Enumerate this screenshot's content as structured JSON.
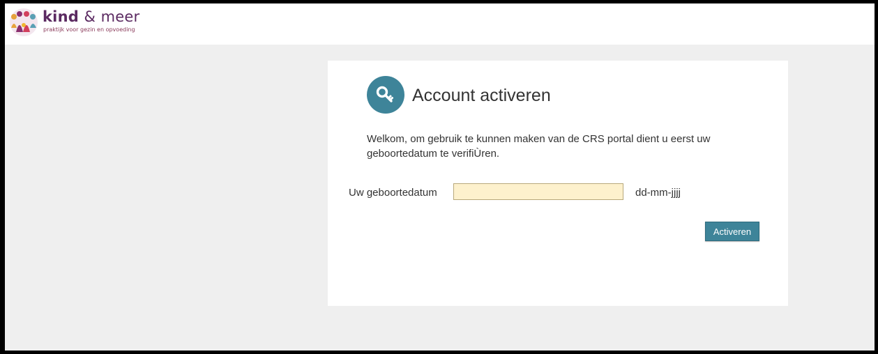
{
  "header": {
    "brand_kind": "kind",
    "brand_amp": "&",
    "brand_meer": "meer",
    "tagline": "praktijk voor gezin en opvoeding"
  },
  "card": {
    "title": "Account activeren",
    "intro": "Welkom, om gebruik te kunnen maken van de CRS portal dient u eerst uw geboortedatum te verifiÙren.",
    "dob_label": "Uw geboortedatum",
    "dob_value": "",
    "dob_hint": "dd-mm-jjjj",
    "activate_label": "Activeren",
    "icon": "key-icon"
  },
  "colors": {
    "accent": "#3e8499",
    "brand": "#5b2a61",
    "input_bg": "#fdf1cd",
    "page_bg": "#efefef"
  }
}
